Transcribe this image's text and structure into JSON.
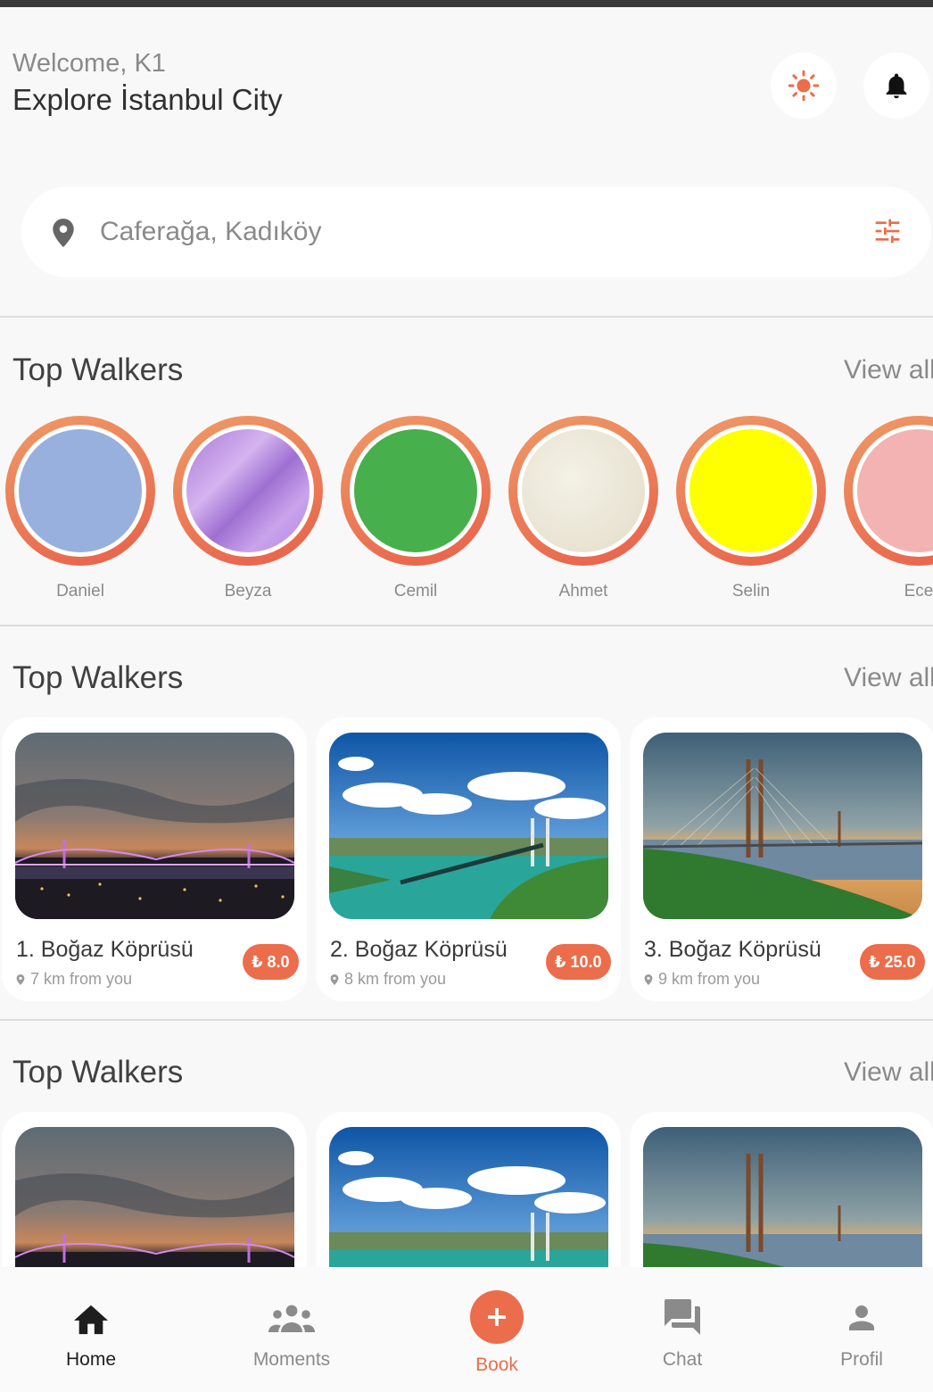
{
  "header": {
    "welcome": "Welcome, K1",
    "headline": "Explore İstanbul City"
  },
  "search": {
    "value": "Caferağa, Kadıköy"
  },
  "icons": {
    "theme": "sun-icon",
    "notifications": "bell-icon",
    "location": "map-pin-icon",
    "filter": "sliders-icon",
    "home": "home-icon",
    "moments": "group-icon",
    "book": "plus-icon",
    "chat": "chat-icon",
    "profile": "person-icon"
  },
  "colors": {
    "accent": "#eb6d4b",
    "ring_start": "#ef9a66",
    "ring_end": "#e8604a"
  },
  "sections": [
    {
      "title": "Top Walkers",
      "view_all": "View all"
    },
    {
      "title": "Top Walkers",
      "view_all": "View all"
    },
    {
      "title": "Top Walkers",
      "view_all": "View all"
    }
  ],
  "walkers": [
    {
      "name": "Daniel",
      "color": "#98b0de"
    },
    {
      "name": "Beyza",
      "color": "#b88ee0"
    },
    {
      "name": "Cemil",
      "color": "#47b04d"
    },
    {
      "name": "Ahmet",
      "color": "#ede8d8"
    },
    {
      "name": "Selin",
      "color": "#ffff00"
    },
    {
      "name": "Ece",
      "color": "#f4b3b3"
    }
  ],
  "places": [
    {
      "name": "1. Boğaz Köprüsü",
      "distance": "7 km from you",
      "price": "₺ 8.0"
    },
    {
      "name": "2. Boğaz Köprüsü",
      "distance": "8 km from you",
      "price": "₺ 10.0"
    },
    {
      "name": "3. Boğaz Köprüsü",
      "distance": "9 km from you",
      "price": "₺ 25.0"
    }
  ],
  "nav": [
    {
      "label": "Home",
      "active": true
    },
    {
      "label": "Moments"
    },
    {
      "label": "Book"
    },
    {
      "label": "Chat"
    },
    {
      "label": "Profil"
    }
  ]
}
